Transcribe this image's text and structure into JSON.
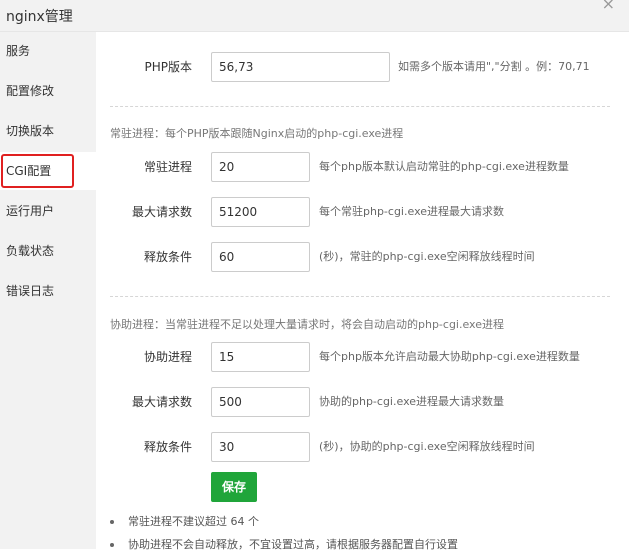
{
  "window": {
    "title": "nginx管理",
    "close_icon": "×"
  },
  "sidebar": {
    "items": [
      {
        "label": "服务"
      },
      {
        "label": "配置修改"
      },
      {
        "label": "切换版本"
      },
      {
        "label": "CGI配置",
        "active": true
      },
      {
        "label": "运行用户"
      },
      {
        "label": "负载状态"
      },
      {
        "label": "错误日志"
      }
    ]
  },
  "php_version": {
    "label": "PHP版本",
    "value": "56,73",
    "hint": "如需多个版本请用\",\"分割 。例：70,71"
  },
  "resident": {
    "section_title": "常驻进程：每个PHP版本跟随Nginx启动的php-cgi.exe进程",
    "fields": [
      {
        "label": "常驻进程",
        "value": "20",
        "hint": "每个php版本默认启动常驻的php-cgi.exe进程数量"
      },
      {
        "label": "最大请求数",
        "value": "51200",
        "hint": "每个常驻php-cgi.exe进程最大请求数"
      },
      {
        "label": "释放条件",
        "value": "60",
        "hint": "(秒)，常驻的php-cgi.exe空闲释放线程时间"
      }
    ]
  },
  "assist": {
    "section_title": "协助进程：当常驻进程不足以处理大量请求时，将会自动启动的php-cgi.exe进程",
    "fields": [
      {
        "label": "协助进程",
        "value": "15",
        "hint": "每个php版本允许启动最大协助php-cgi.exe进程数量"
      },
      {
        "label": "最大请求数",
        "value": "500",
        "hint": "协助的php-cgi.exe进程最大请求数量"
      },
      {
        "label": "释放条件",
        "value": "30",
        "hint": "(秒)，协助的php-cgi.exe空闲释放线程时间"
      }
    ]
  },
  "save_label": "保存",
  "tips": [
    "常驻进程不建议超过 64 个",
    "协助进程不会自动释放，不宜设置过高，请根据服务器配置自行设置"
  ],
  "colors": {
    "accent": "#20a53a",
    "highlight": "#e02020"
  }
}
